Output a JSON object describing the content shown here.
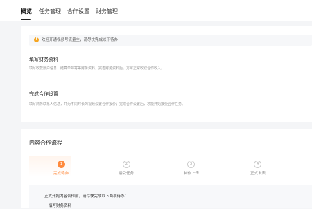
{
  "tabs": [
    {
      "label": "概览",
      "active": true
    },
    {
      "label": "任务管理",
      "active": false
    },
    {
      "label": "合作设置",
      "active": false
    },
    {
      "label": "财务管理",
      "active": false
    }
  ],
  "notice": {
    "text": "欢迎开通视频号流量主，请尽快完成以下待办："
  },
  "sections": [
    {
      "title": "填写财务资料",
      "desc": "填写收款账户信息、结算单邮寄等财务资料，完善财务资料后，方可正常收取合作收入。"
    },
    {
      "title": "完成合作设置",
      "desc": "填写商务联系人信息，并为不同时长的视频设置合作报价；完成合作设置后，才能开始接受合作任务。"
    }
  ],
  "flow": {
    "title": "内容合作流程",
    "steps": [
      {
        "num": "1",
        "label": "完成待办",
        "active": true
      },
      {
        "num": "2",
        "label": "接受任务",
        "active": false
      },
      {
        "num": "3",
        "label": "制作上传",
        "active": false
      },
      {
        "num": "4",
        "label": "正式发表",
        "active": false
      }
    ],
    "pane_text": "正式开始内容合作前，请尽快完成以下两项待办：",
    "pane_sub": "填写财务资料"
  },
  "colors": {
    "accent": "#ff8a3d",
    "notice_icon": "#f5a623"
  }
}
